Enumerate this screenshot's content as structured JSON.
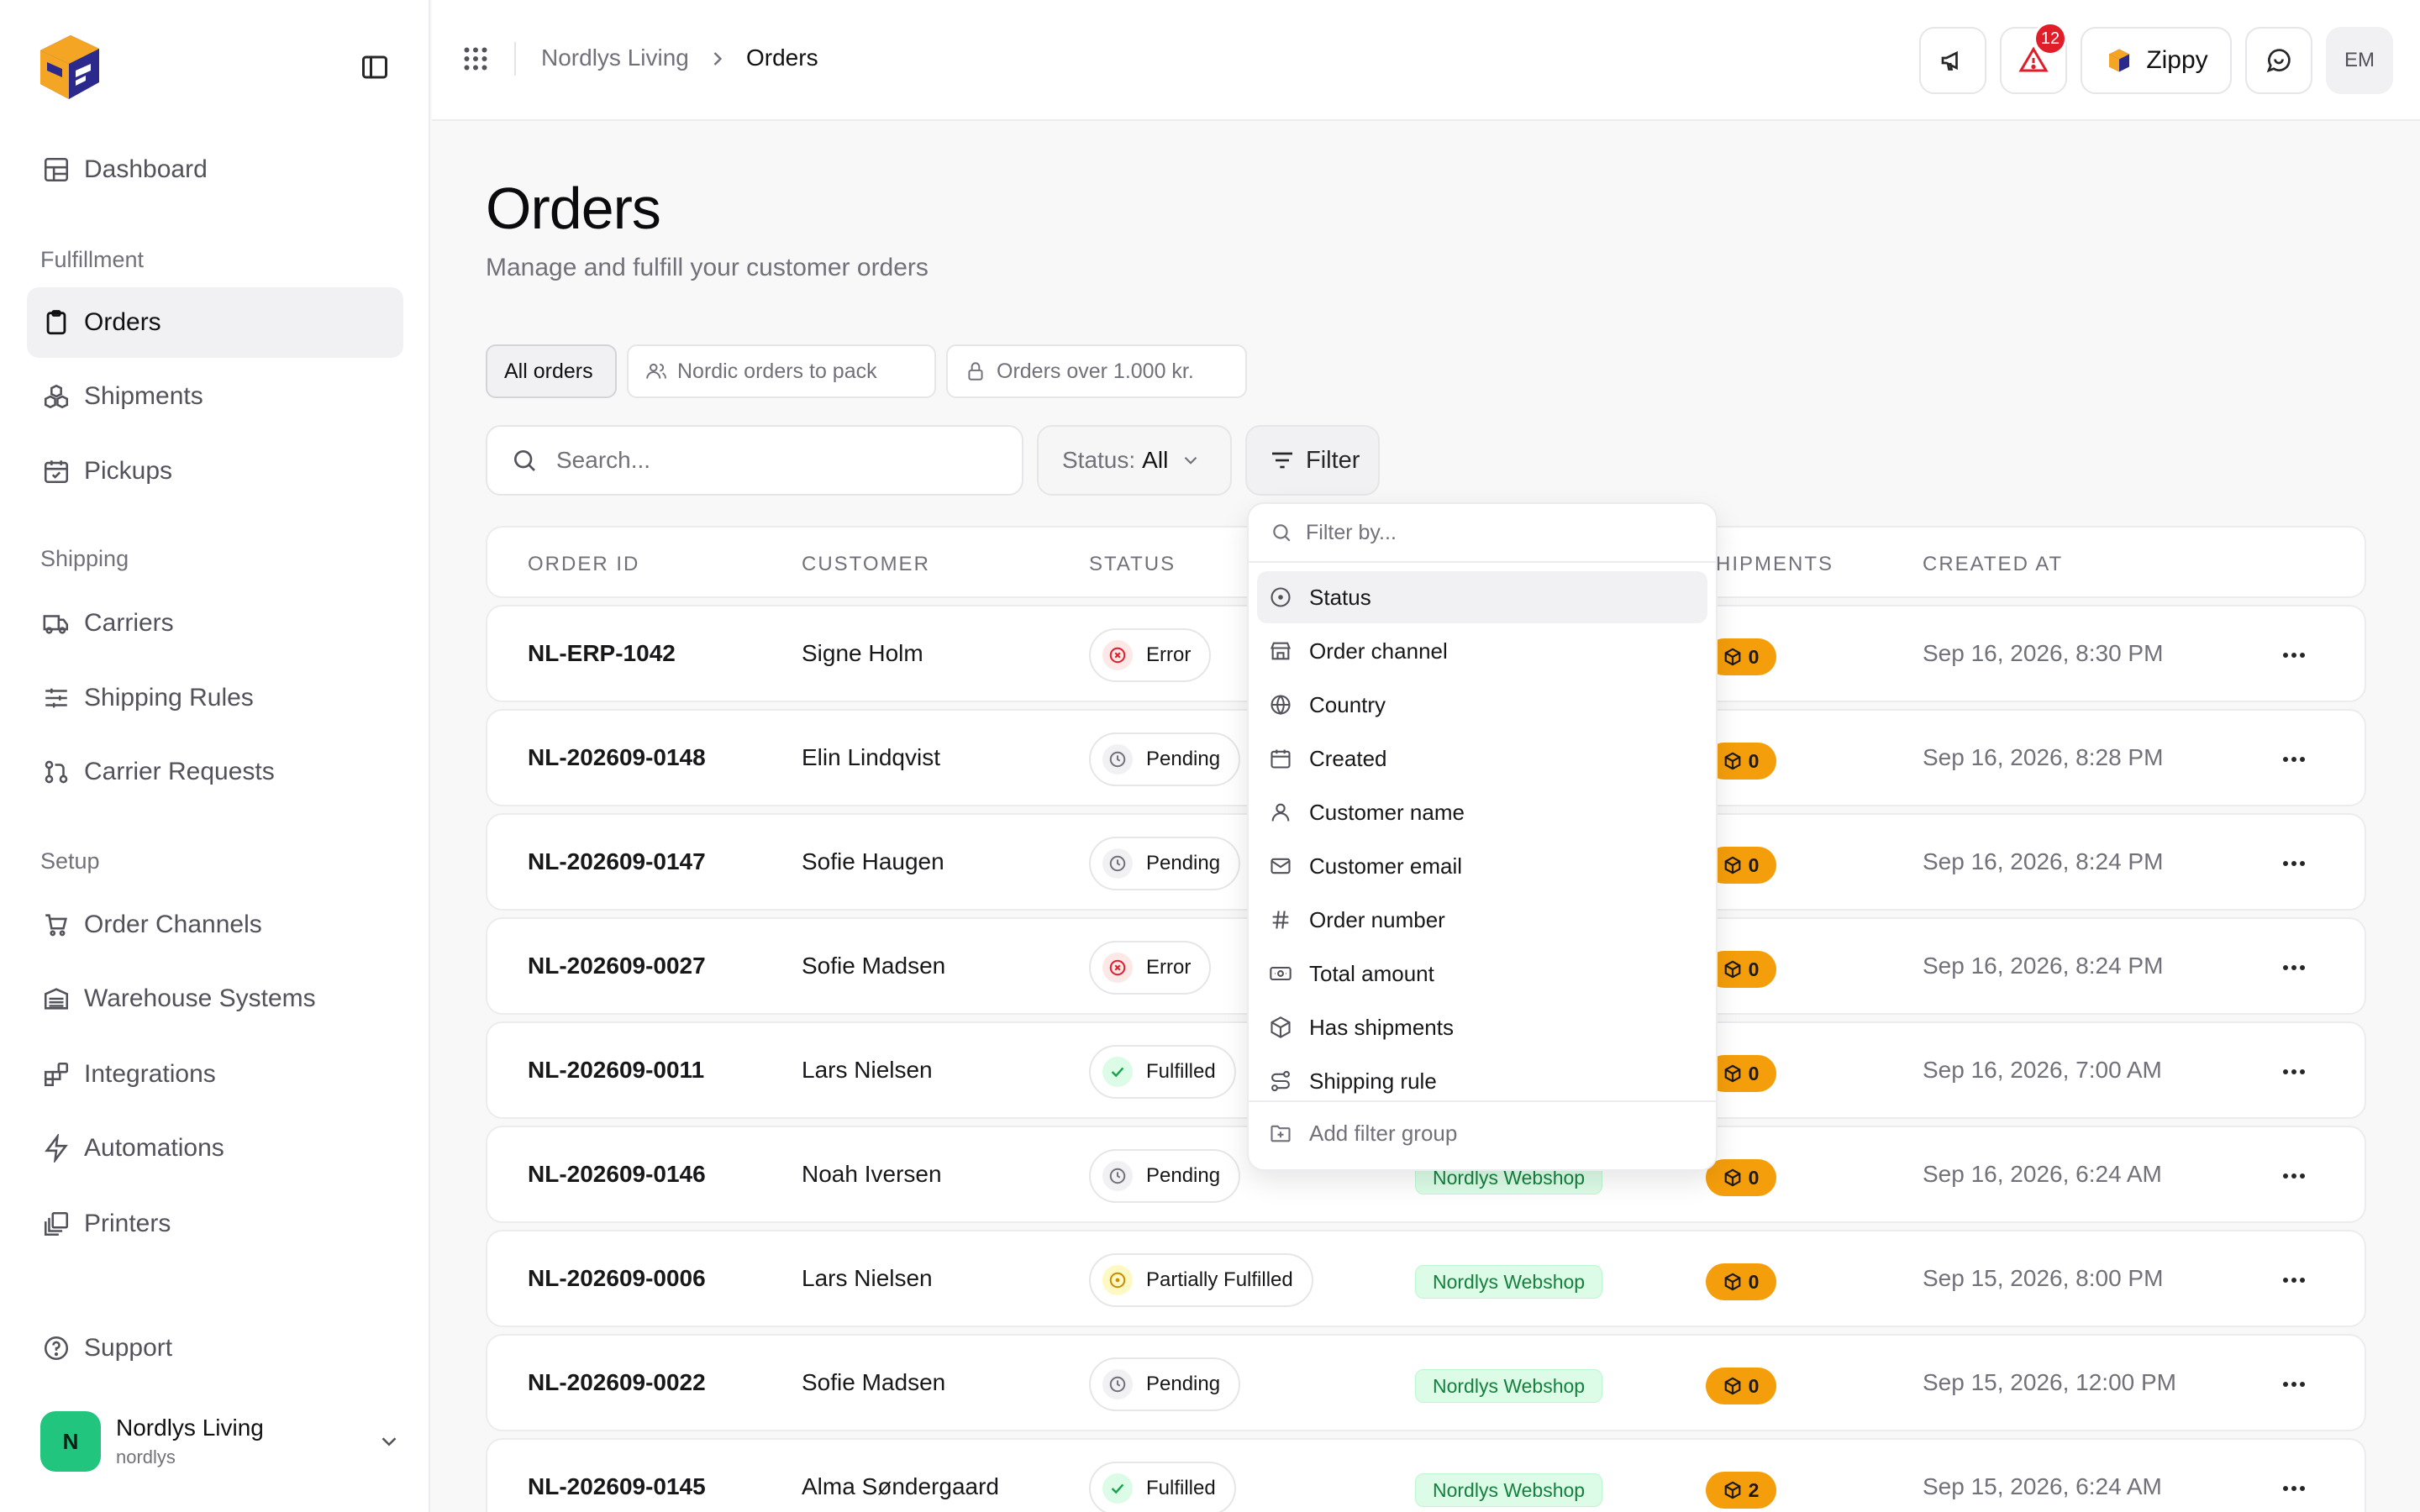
{
  "sidebar": {
    "nav": [
      {
        "label": "Dashboard",
        "icon": "dashboard-icon"
      },
      {
        "label": "Orders",
        "icon": "clipboard-icon",
        "active": true
      },
      {
        "label": "Shipments",
        "icon": "boxes-icon"
      },
      {
        "label": "Pickups",
        "icon": "calendar-check-icon"
      },
      {
        "label": "Carriers",
        "icon": "truck-icon"
      },
      {
        "label": "Shipping Rules",
        "icon": "sliders-icon"
      },
      {
        "label": "Carrier Requests",
        "icon": "git-pull-request-icon"
      },
      {
        "label": "Order Channels",
        "icon": "cart-icon"
      },
      {
        "label": "Warehouse Systems",
        "icon": "warehouse-icon"
      },
      {
        "label": "Integrations",
        "icon": "blocks-icon"
      },
      {
        "label": "Automations",
        "icon": "zap-icon"
      },
      {
        "label": "Printers",
        "icon": "printer-stack-icon"
      },
      {
        "label": "Support",
        "icon": "help-circle-icon"
      }
    ],
    "sections": {
      "fulfillment": "Fulfillment",
      "shipping": "Shipping",
      "setup": "Setup"
    },
    "account": {
      "initial": "N",
      "name": "Nordlys Living",
      "handle": "nordlys"
    }
  },
  "topbar": {
    "breadcrumb": [
      "Nordlys Living",
      "Orders"
    ],
    "alerts_count": "12",
    "assistant_label": "Zippy",
    "user_initials": "EM"
  },
  "page": {
    "title": "Orders",
    "subtitle": "Manage and fulfill your customer orders"
  },
  "views": [
    {
      "label": "All orders",
      "active": true
    },
    {
      "label": "Nordic orders to pack",
      "icon": "users-icon"
    },
    {
      "label": "Orders over 1.000 kr.",
      "icon": "lock-icon"
    }
  ],
  "toolbar": {
    "search_placeholder": "Search...",
    "status_label": "Status:",
    "status_value": "All",
    "filter_label": "Filter"
  },
  "table": {
    "columns": [
      "ORDER ID",
      "CUSTOMER",
      "STATUS",
      "HIPMENTS",
      "CREATED AT"
    ],
    "rows": [
      {
        "id": "NL-ERP-1042",
        "customer": "Signe Holm",
        "status": "Error",
        "channel": "",
        "shipments": "0",
        "created": "Sep 16, 2026, 8:30 PM"
      },
      {
        "id": "NL-202609-0148",
        "customer": "Elin Lindqvist",
        "status": "Pending",
        "channel": "",
        "shipments": "0",
        "created": "Sep 16, 2026, 8:28 PM"
      },
      {
        "id": "NL-202609-0147",
        "customer": "Sofie Haugen",
        "status": "Pending",
        "channel": "",
        "shipments": "0",
        "created": "Sep 16, 2026, 8:24 PM"
      },
      {
        "id": "NL-202609-0027",
        "customer": "Sofie Madsen",
        "status": "Error",
        "channel": "",
        "shipments": "0",
        "created": "Sep 16, 2026, 8:24 PM"
      },
      {
        "id": "NL-202609-0011",
        "customer": "Lars Nielsen",
        "status": "Fulfilled",
        "channel": "",
        "shipments": "0",
        "created": "Sep 16, 2026, 7:00 AM"
      },
      {
        "id": "NL-202609-0146",
        "customer": "Noah Iversen",
        "status": "Pending",
        "channel": "Nordlys Webshop",
        "shipments": "0",
        "created": "Sep 16, 2026, 6:24 AM"
      },
      {
        "id": "NL-202609-0006",
        "customer": "Lars Nielsen",
        "status": "Partially Fulfilled",
        "channel": "Nordlys Webshop",
        "shipments": "0",
        "created": "Sep 15, 2026, 8:00 PM"
      },
      {
        "id": "NL-202609-0022",
        "customer": "Sofie Madsen",
        "status": "Pending",
        "channel": "Nordlys Webshop",
        "shipments": "0",
        "created": "Sep 15, 2026, 12:00 PM"
      },
      {
        "id": "NL-202609-0145",
        "customer": "Alma Søndergaard",
        "status": "Fulfilled",
        "channel": "Nordlys Webshop",
        "shipments": "2",
        "created": "Sep 15, 2026, 6:24 AM"
      }
    ]
  },
  "filter_menu": {
    "placeholder": "Filter by...",
    "items": [
      {
        "label": "Status",
        "icon": "circle-dot-icon"
      },
      {
        "label": "Order channel",
        "icon": "store-icon"
      },
      {
        "label": "Country",
        "icon": "globe-icon"
      },
      {
        "label": "Created",
        "icon": "calendar-icon"
      },
      {
        "label": "Customer name",
        "icon": "user-icon"
      },
      {
        "label": "Customer email",
        "icon": "mail-icon"
      },
      {
        "label": "Order number",
        "icon": "hash-icon"
      },
      {
        "label": "Total amount",
        "icon": "banknote-icon"
      },
      {
        "label": "Has shipments",
        "icon": "package-icon"
      },
      {
        "label": "Shipping rule",
        "icon": "route-icon"
      }
    ],
    "add_group_label": "Add filter group"
  },
  "colors": {
    "error": "#e11d2a",
    "pending": "#71717a",
    "fulfilled": "#16a34a",
    "partial": "#ca8a04",
    "channel_bg": "#dcfce7",
    "shipments_badge": "#f59e0b",
    "brand_orange": "#f5a524",
    "brand_navy": "#2b2a8c"
  }
}
